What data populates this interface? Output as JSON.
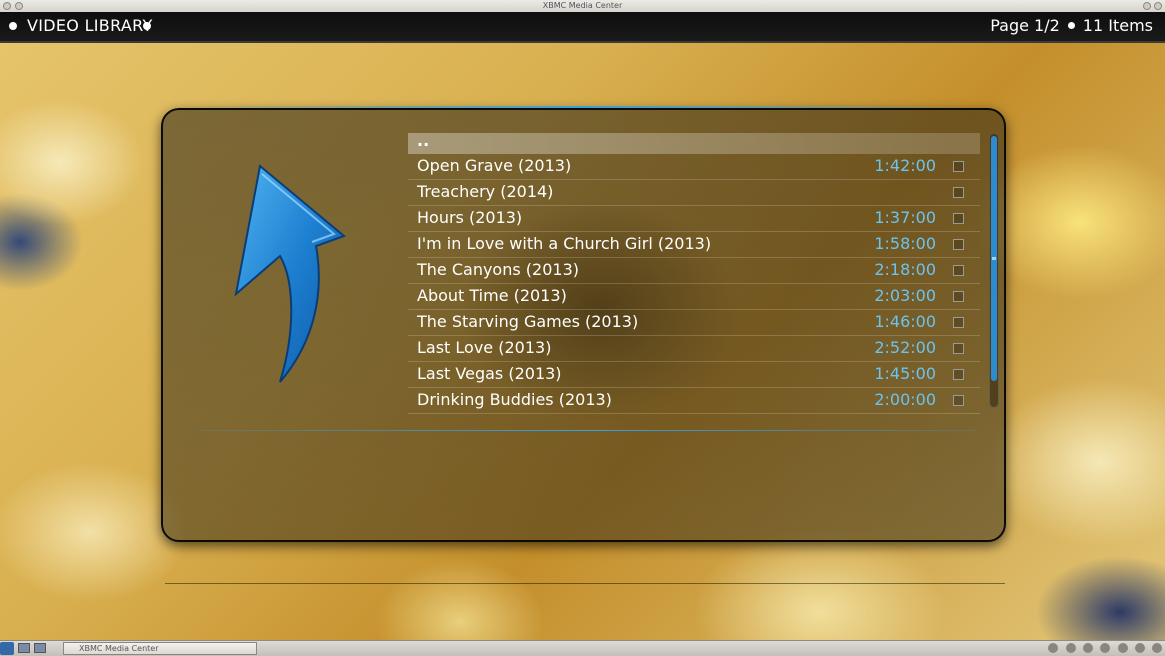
{
  "window": {
    "title": "XBMC Media Center"
  },
  "header": {
    "title": "VIDEO LIBRARY",
    "page": "Page 1/2",
    "items": "11 Items"
  },
  "list": {
    "parent_label": "..",
    "items": [
      {
        "title": "Open Grave (2013)",
        "duration": "1:42:00"
      },
      {
        "title": "Treachery (2014)",
        "duration": ""
      },
      {
        "title": "Hours (2013)",
        "duration": "1:37:00"
      },
      {
        "title": "I'm in Love with a Church Girl (2013)",
        "duration": "1:58:00"
      },
      {
        "title": "The Canyons (2013)",
        "duration": "2:18:00"
      },
      {
        "title": "About Time (2013)",
        "duration": "2:03:00"
      },
      {
        "title": "The Starving Games (2013)",
        "duration": "1:46:00"
      },
      {
        "title": "Last Love (2013)",
        "duration": "2:52:00"
      },
      {
        "title": "Last Vegas (2013)",
        "duration": "1:45:00"
      },
      {
        "title": "Drinking Buddies (2013)",
        "duration": "2:00:00"
      }
    ]
  },
  "taskbar": {
    "task_label": "XBMC Media Center"
  },
  "icons": {
    "parent_folder": "up-arrow-icon"
  },
  "colors": {
    "accent": "#38a0dc",
    "duration_text": "#6cc3f0"
  }
}
